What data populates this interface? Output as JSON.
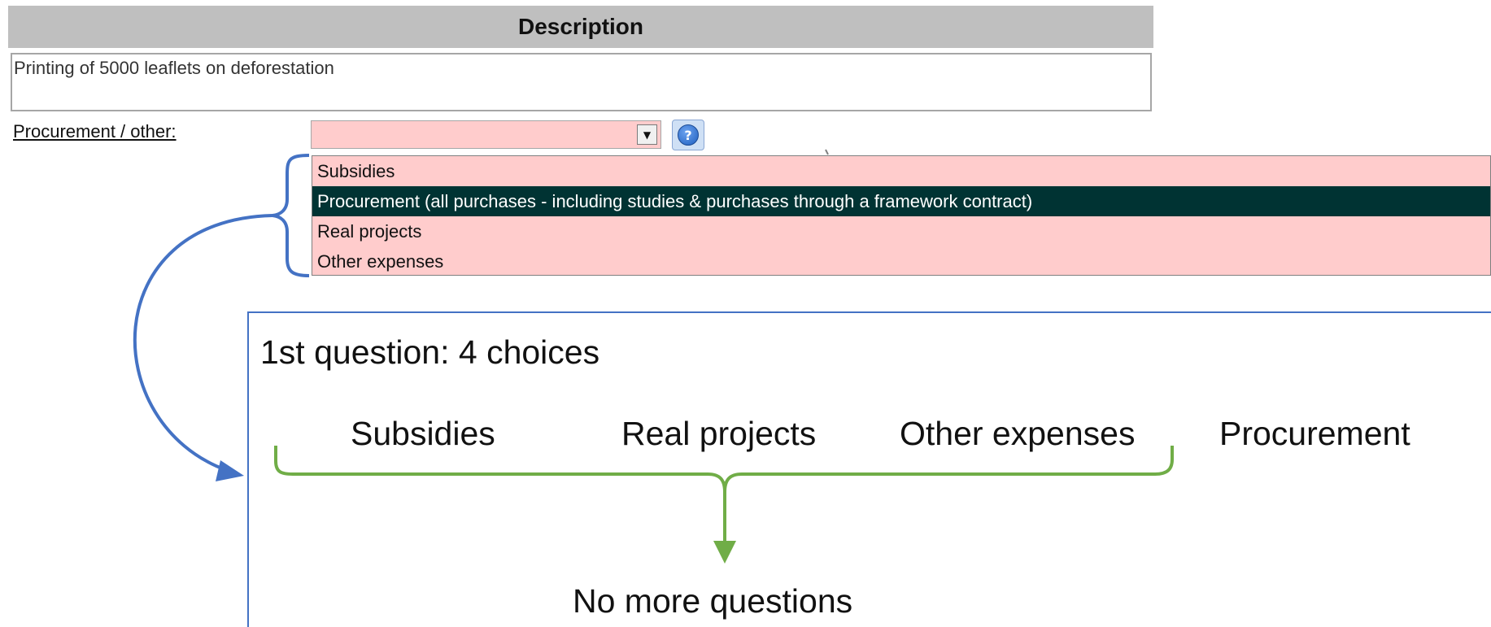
{
  "description": {
    "header": "Description",
    "value": "Printing of 5000 leaflets on deforestation"
  },
  "procurement": {
    "label": "Procurement / other:",
    "selected_value": "",
    "dropdown_icon": "chevron-down-icon",
    "help_icon": "help-icon",
    "help_glyph": "?"
  },
  "dropdown": {
    "options": [
      "Subsidies",
      "Procurement (all purchases - including studies & purchases through a framework contract)",
      "Real projects",
      "Other expenses"
    ],
    "selected_index": 1
  },
  "annotation": {
    "title": "1st question: 4 choices",
    "choices": [
      "Subsidies",
      "Real projects",
      "Other expenses",
      "Procurement"
    ],
    "result": "No more questions"
  },
  "colors": {
    "field_bg": "#ffcccc",
    "selected_bg": "#003333",
    "header_bg": "#bfbfbf",
    "blue_annotation": "#4472c4",
    "green_annotation": "#70ad47"
  }
}
